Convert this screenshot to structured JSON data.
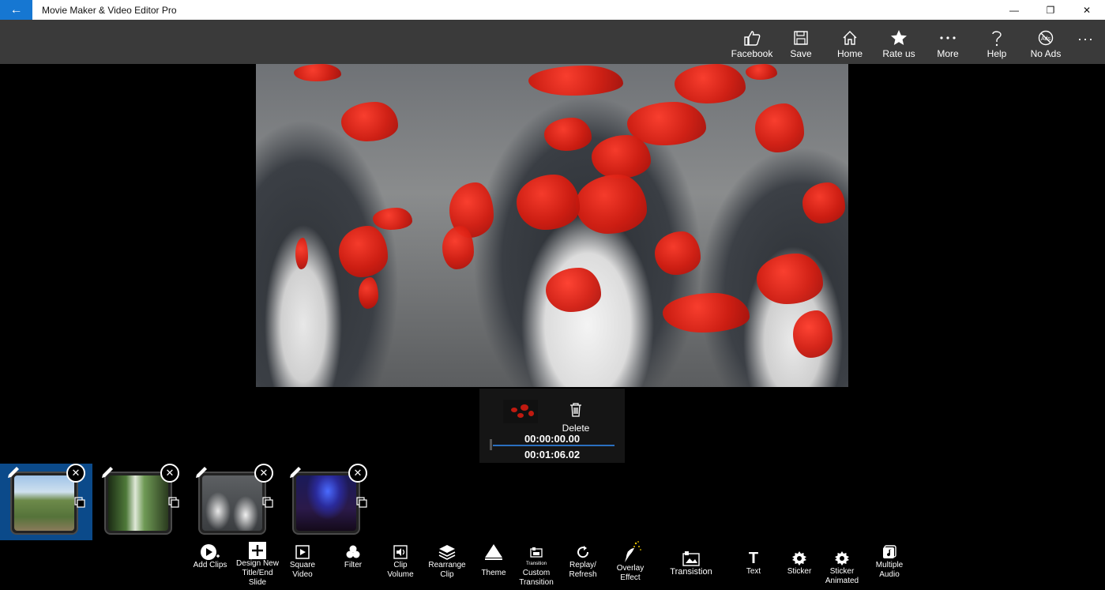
{
  "window": {
    "title": "Movie Maker & Video Editor Pro",
    "back_glyph": "←",
    "minimize_glyph": "—",
    "restore_glyph": "❐",
    "close_glyph": "✕"
  },
  "commands": [
    {
      "label": "Facebook",
      "icon": "thumbs-up-icon"
    },
    {
      "label": "Save",
      "icon": "floppy-disk-icon"
    },
    {
      "label": "Home",
      "icon": "home-icon"
    },
    {
      "label": "Rate us",
      "icon": "star-icon"
    },
    {
      "label": "More",
      "icon": "more-dots-icon"
    },
    {
      "label": "Help",
      "icon": "question-icon"
    },
    {
      "label": "No Ads",
      "icon": "no-ads-icon"
    }
  ],
  "command_overflow_glyph": "···",
  "clip_panel": {
    "delete_label": "Delete",
    "start_time": "00:00:00.00",
    "end_time": "00:01:06.02"
  },
  "clips": [
    {
      "id": 1,
      "selected": true
    },
    {
      "id": 2,
      "selected": false
    },
    {
      "id": 3,
      "selected": false
    },
    {
      "id": 4,
      "selected": false
    }
  ],
  "toolbar": {
    "add_clips": "Add Clips",
    "design_title_1": "Design New",
    "design_title_2": "Title/End",
    "design_title_3": "Slide",
    "square_video_1": "Square",
    "square_video_2": "Video",
    "filter": "Filter",
    "clip_volume_1": "Clip",
    "clip_volume_2": "Volume",
    "rearrange_1": "Rearrange",
    "rearrange_2": "Clip",
    "theme": "Theme",
    "custom_transition_icon_text": "Transition",
    "custom_transition_1": "Custom",
    "custom_transition_2": "Transition",
    "replay_1": "Replay/",
    "replay_2": "Refresh",
    "overlay_1": "Overlay",
    "overlay_2": "Effect",
    "transition": "Transistion",
    "text": "Text",
    "text_glyph": "T",
    "sticker": "Sticker",
    "sticker_animated_1": "Sticker",
    "sticker_animated_2": "Animated",
    "multiple_audio_1": "Multiple",
    "multiple_audio_2": "Audio"
  },
  "colors": {
    "accent": "#1677d2",
    "command_bar": "#3a3a3a",
    "selected_clip": "#0b4a8a",
    "timeline": "#2a6fc0"
  }
}
